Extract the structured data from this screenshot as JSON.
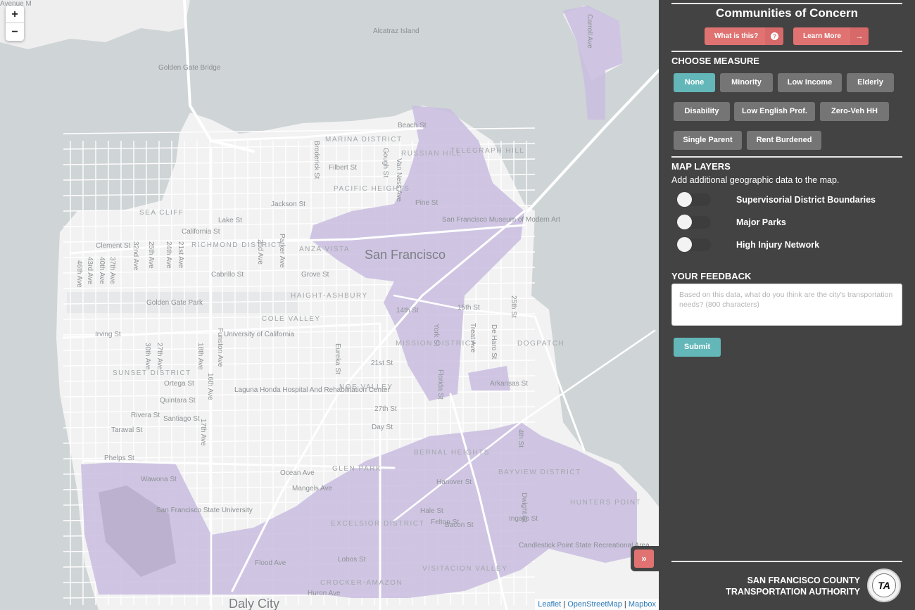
{
  "panel": {
    "title": "Communities of Concern",
    "what_is_this": {
      "label": "What is this?",
      "icon": "question-circle-icon"
    },
    "learn_more": {
      "label": "Learn More",
      "icon": "arrow-right-icon"
    },
    "choose_measure": {
      "heading": "CHOOSE MEASURE",
      "selected": "None",
      "options": [
        "None",
        "Minority",
        "Low Income",
        "Elderly",
        "Disability",
        "Low English Prof.",
        "Zero-Veh HH",
        "Single Parent",
        "Rent Burdened"
      ]
    },
    "map_layers": {
      "heading": "MAP LAYERS",
      "subtitle": "Add additional geographic data to the map.",
      "layers": [
        {
          "label": "Supervisorial District Boundaries",
          "enabled": false
        },
        {
          "label": "Major Parks",
          "enabled": false
        },
        {
          "label": "High Injury Network",
          "enabled": false
        }
      ]
    },
    "feedback": {
      "heading": "YOUR FEEDBACK",
      "placeholder": "Based on this data, what do you think are the city's transportation needs? (800 characters)",
      "value": "",
      "submit_label": "Submit"
    },
    "org": {
      "line1": "SAN FRANCISCO COUNTY",
      "line2": "TRANSPORTATION AUTHORITY",
      "logo_text": "TA"
    }
  },
  "map": {
    "zoom_in": "+",
    "zoom_out": "−",
    "toggle_panel": "»",
    "attribution": [
      "Leaflet",
      "OpenStreetMap",
      "Mapbox"
    ],
    "colors": {
      "water": "#cfd4d6",
      "land": "#f2f2f2",
      "road": "#ffffff",
      "highlight": "#c9bde0"
    },
    "labels": {
      "pois": [
        "Alcatraz Island",
        "Golden Gate Bridge",
        "Golden Gate Park",
        "University of California",
        "Laguna Honda Hospital And Rehabilitation Center",
        "San Francisco State University",
        "San Francisco Museum of Modern Art",
        "Candlestick Point State Recreational Area"
      ],
      "districts": [
        "MARINA DISTRICT",
        "RUSSIAN HILL",
        "TELEGRAPH HILL",
        "PACIFIC HEIGHTS",
        "SEA CLIFF",
        "RICHMOND DISTRICT",
        "ANZA VISTA",
        "HAIGHT-ASHBURY",
        "COLE VALLEY",
        "SUNSET DISTRICT",
        "MISSION DISTRICT",
        "NOE VALLEY",
        "BERNAL HEIGHTS",
        "GLEN PARK",
        "BAYVIEW DISTRICT",
        "HUNTERS POINT",
        "DOGPATCH",
        "EXCELSIOR DISTRICT",
        "CROCKER-AMAZON",
        "VISITACION VALLEY"
      ],
      "cities": [
        "San Francisco",
        "Daly City"
      ],
      "streets": [
        "Beach St",
        "Broderick St",
        "Filbert St",
        "Gough St",
        "Van Ness Ave",
        "Jackson St",
        "Lake St",
        "California St",
        "Clement St",
        "32nd Ave",
        "25th Ave",
        "24th Ave",
        "21st Ave",
        "2nd Ave",
        "Parker Ave",
        "46th Ave",
        "43rd Ave",
        "40th Ave",
        "37th Ave",
        "Cabrillo St",
        "Grove St",
        "Pine St",
        "Irving St",
        "30th Ave",
        "27th Ave",
        "18th Ave",
        "Funston Ave",
        "16th Ave",
        "17th Ave",
        "Ortega St",
        "Quintara St",
        "Rivera St",
        "Santiago St",
        "Taraval St",
        "Eureka St",
        "21st St",
        "27th St",
        "Day St",
        "14th St",
        "15th St",
        "Florida St",
        "York St",
        "Treat Ave",
        "De Haro St",
        "Arkansas St",
        "25th St",
        "4th St",
        "Phelps St",
        "Wawona St",
        "Ocean Ave",
        "Mangels Ave",
        "Flood Ave",
        "Lobos St",
        "Huron Ave",
        "Hanover St",
        "Hale St",
        "Felton St",
        "Bacon St",
        "Dwight St",
        "Ingalls St",
        "Carroll Ave",
        "Avenue M"
      ]
    }
  }
}
